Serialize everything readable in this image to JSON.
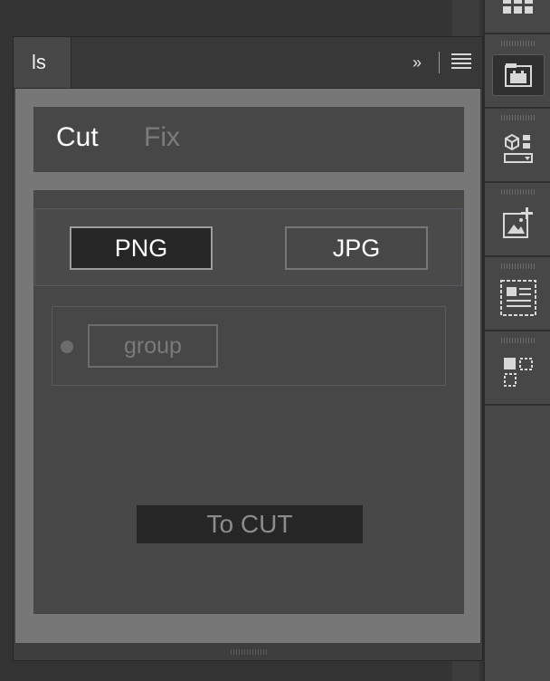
{
  "panel": {
    "tab_label": "ls",
    "collapse_glyph": "»",
    "menu_icon": "hamburger-menu-icon"
  },
  "mode_tabs": [
    {
      "label": "Cut",
      "active": true
    },
    {
      "label": "Fix",
      "active": false
    }
  ],
  "format": {
    "options": [
      {
        "label": "PNG",
        "selected": true
      },
      {
        "label": "JPG",
        "selected": false
      }
    ]
  },
  "group": {
    "label": "group",
    "enabled": false
  },
  "action": {
    "label": "To CUT"
  },
  "toolbar": {
    "icons": [
      "grid-icon",
      "plugin-panel-icon",
      "3d-object-icon",
      "add-image-icon",
      "layout-text-icon",
      "select-shapes-icon"
    ],
    "active_icon": "plugin-panel-icon"
  },
  "colors": {
    "background": "#343434",
    "panel": "#474747",
    "panel_frame": "#777777",
    "selected_button": "#262626",
    "active_text": "#ffffff",
    "inactive_text": "#7c7c7c"
  }
}
